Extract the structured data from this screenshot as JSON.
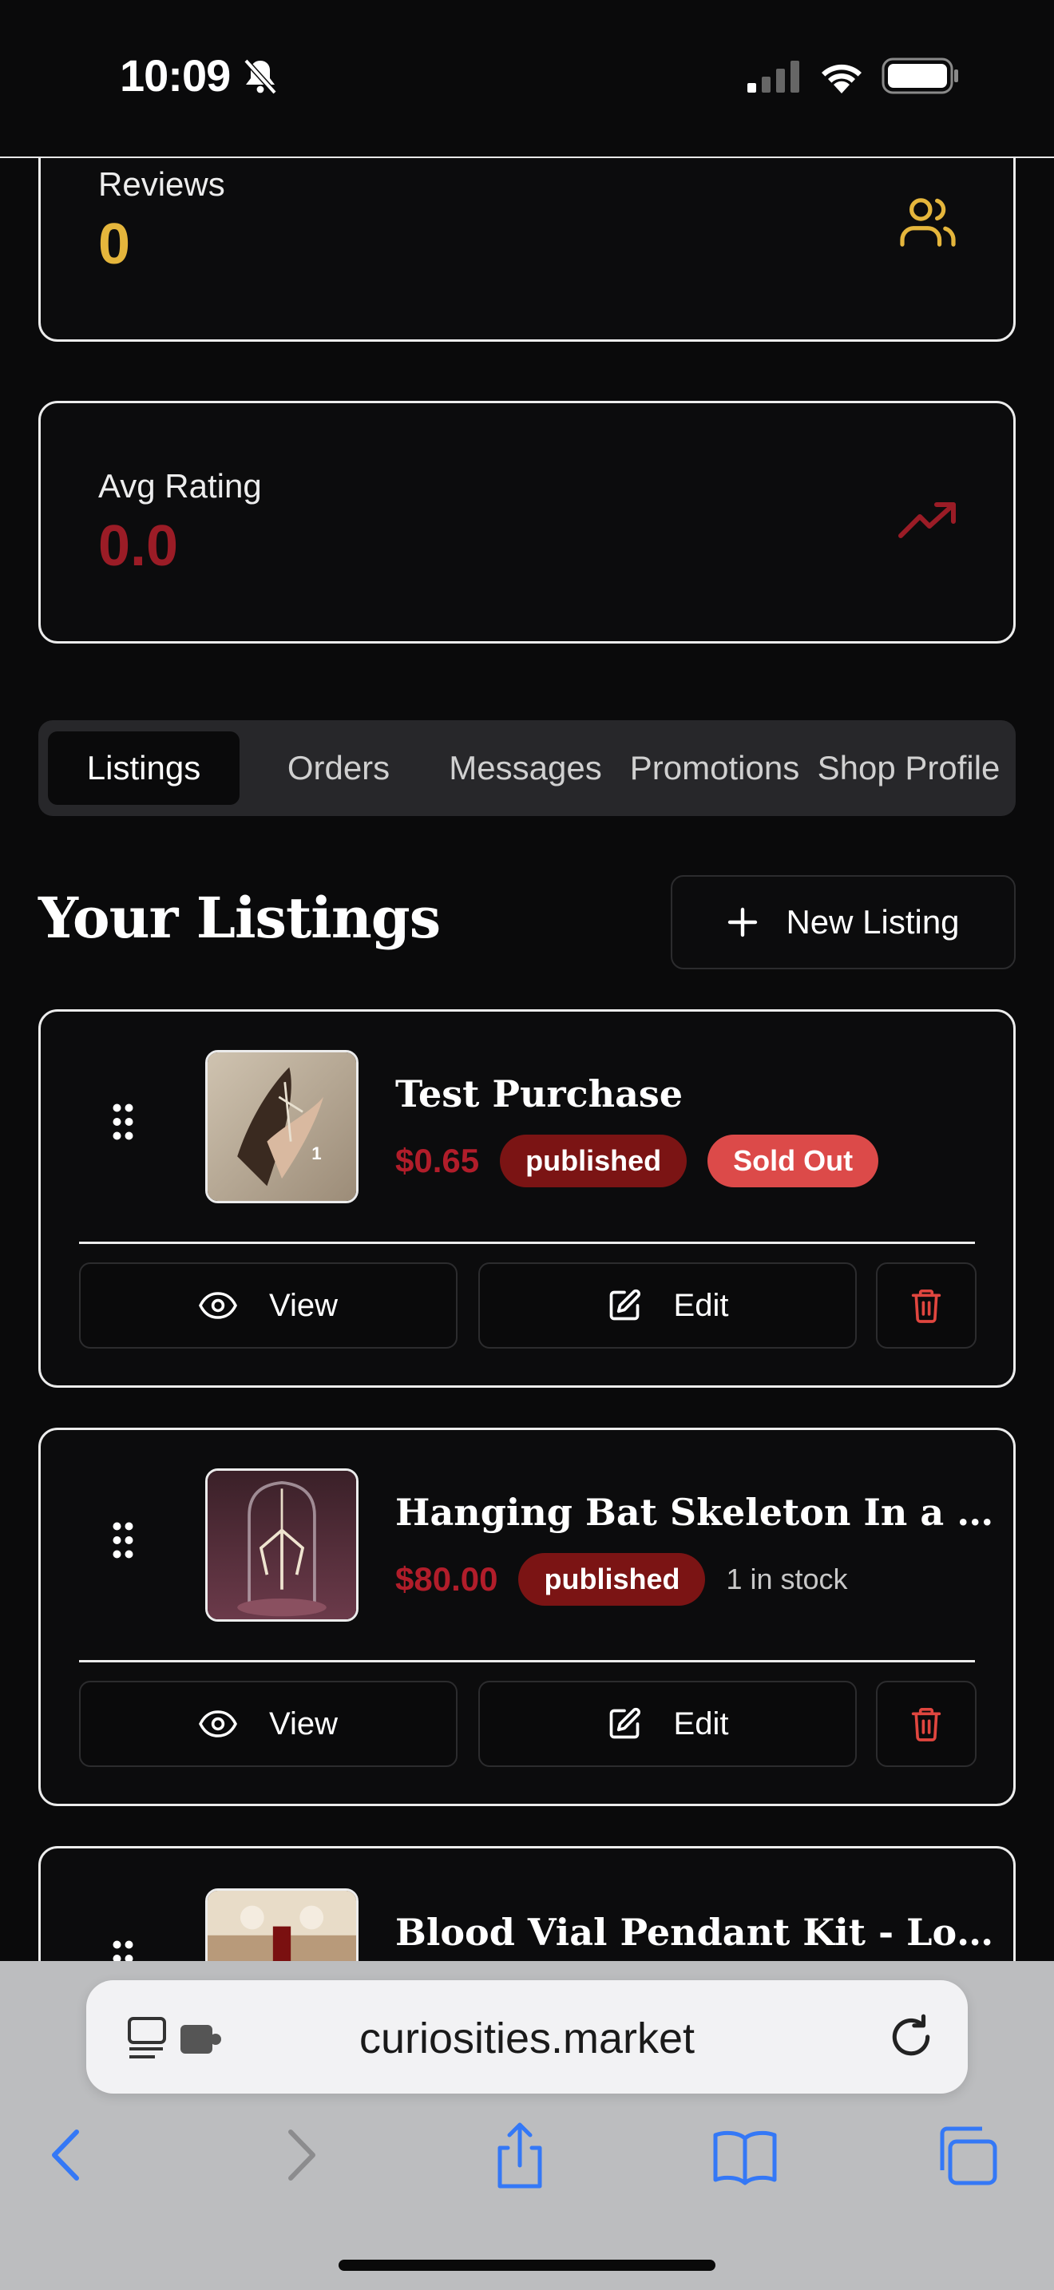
{
  "status_bar": {
    "time": "10:09"
  },
  "stats": {
    "reviews": {
      "label": "Reviews",
      "value": "0",
      "color": "#e5b63c"
    },
    "avg_rating": {
      "label": "Avg Rating",
      "value": "0.0",
      "color": "#9b1c26"
    }
  },
  "tabs": [
    {
      "label": "Listings",
      "active": true
    },
    {
      "label": "Orders",
      "active": false
    },
    {
      "label": "Messages",
      "active": false
    },
    {
      "label": "Promotions",
      "active": false
    },
    {
      "label": "Shop Profile",
      "active": false
    }
  ],
  "listings_section": {
    "title": "Your Listings",
    "new_listing_label": "New Listing"
  },
  "listings": [
    {
      "title": "Test Purchase",
      "price": "$0.65",
      "status": "published",
      "stock_badge": "Sold Out",
      "view_label": "View",
      "edit_label": "Edit"
    },
    {
      "title": "Hanging Bat Skeleton In a Glas...",
      "price": "$80.00",
      "status": "published",
      "stock_text": "1 in stock",
      "view_label": "View",
      "edit_label": "Edit"
    },
    {
      "title": "Blood Vial Pendant Kit - Lover..."
    }
  ],
  "browser": {
    "url": "curiosities.market"
  },
  "colors": {
    "accent_red": "#b11d2a",
    "badge_published": "#7b1414",
    "badge_soldout": "#dc4a49",
    "ios_blue": "#3478f6"
  }
}
